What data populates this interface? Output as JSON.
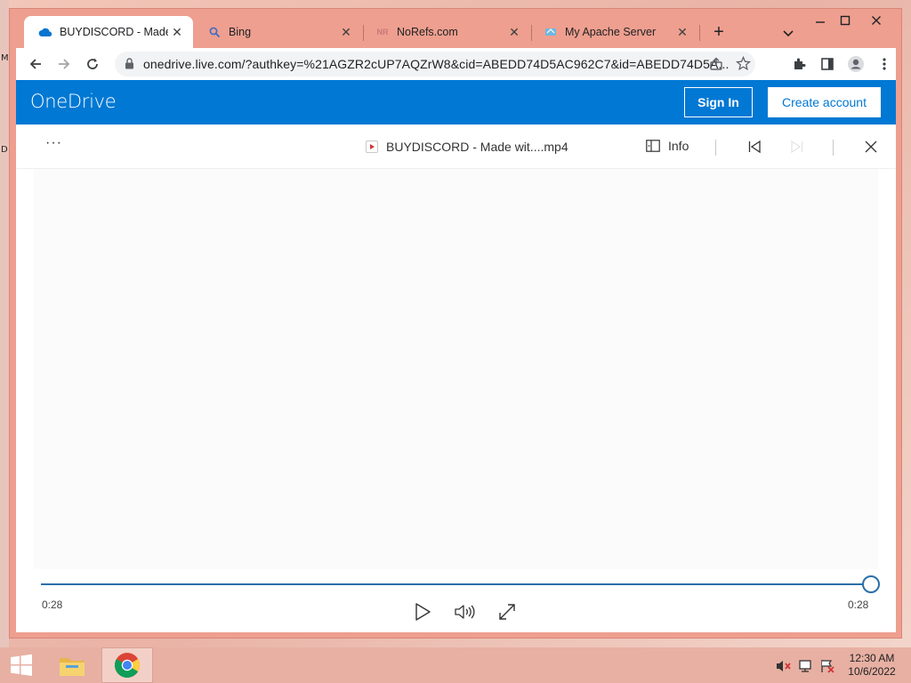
{
  "desktop": {
    "edge_chars": [
      "M",
      "D"
    ]
  },
  "browser": {
    "tabs": [
      {
        "title": "BUYDISCORD - Made w",
        "icon": "onedrive-cloud-icon",
        "active": true
      },
      {
        "title": "Bing",
        "icon": "search-icon",
        "active": false
      },
      {
        "title": "NoRefs.com",
        "icon": "norefs-icon",
        "active": false
      },
      {
        "title": "My Apache Server",
        "icon": "apache-icon",
        "active": false
      }
    ],
    "url": "onedrive.live.com/?authkey=%21AGZR2cUP7AQZrW8&cid=ABEDD74D5AC962C7&id=ABEDD74D5A...",
    "colors": {
      "frame": "#ee9f8f",
      "accent": "#0078d4"
    }
  },
  "onedrive": {
    "brand": "OneDrive",
    "sign_in_label": "Sign In",
    "create_account_label": "Create account"
  },
  "viewer": {
    "more_label": "···",
    "file_title": "BUYDISCORD - Made wit....mp4",
    "info_label": "Info",
    "progress": 1.0,
    "current_time": "0:28",
    "total_time": "0:28"
  },
  "taskbar": {
    "time": "12:30 AM",
    "date": "10/6/2022"
  }
}
